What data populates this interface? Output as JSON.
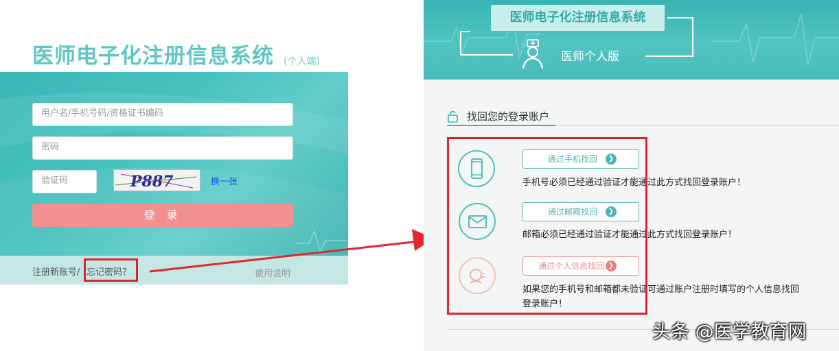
{
  "login": {
    "app_title": "医师电子化注册信息系统",
    "app_subtitle": "(个人端)",
    "username_placeholder": "用户名/手机号码/资格证书编码",
    "password_placeholder": "密码",
    "captcha_placeholder": "验证码",
    "captcha_text": "P887",
    "captcha_refresh": "换一张",
    "login_button": "登 录",
    "register_link": "注册新账号/",
    "forgot_link": "忘记密码？",
    "help_link": "使用说明"
  },
  "recover": {
    "header_title": "医师电子化注册信息系统",
    "header_subtitle": "医师个人版",
    "section_title": "找回您的登录账户",
    "options": [
      {
        "button": "通过手机找回",
        "icon": "phone-icon",
        "desc": "手机号必须已经通过验证才能通过此方式找回登录账户！"
      },
      {
        "button": "通过邮箱找回",
        "icon": "mail-icon",
        "desc": "邮箱必须已经通过验证才能通过此方式找回登录账户！"
      },
      {
        "button": "通过个人信息找回",
        "icon": "person-info-icon",
        "desc_line1": "如果您的手机号和邮箱都未验证可通过账户注册时填写的个人信息找回",
        "desc_line2": "登录账户！"
      }
    ]
  },
  "watermark": "头条 @医学教育网",
  "colors": {
    "teal": "#4dbfbd",
    "pink_button": "#f28f8f",
    "highlight_red": "#d9262c"
  }
}
